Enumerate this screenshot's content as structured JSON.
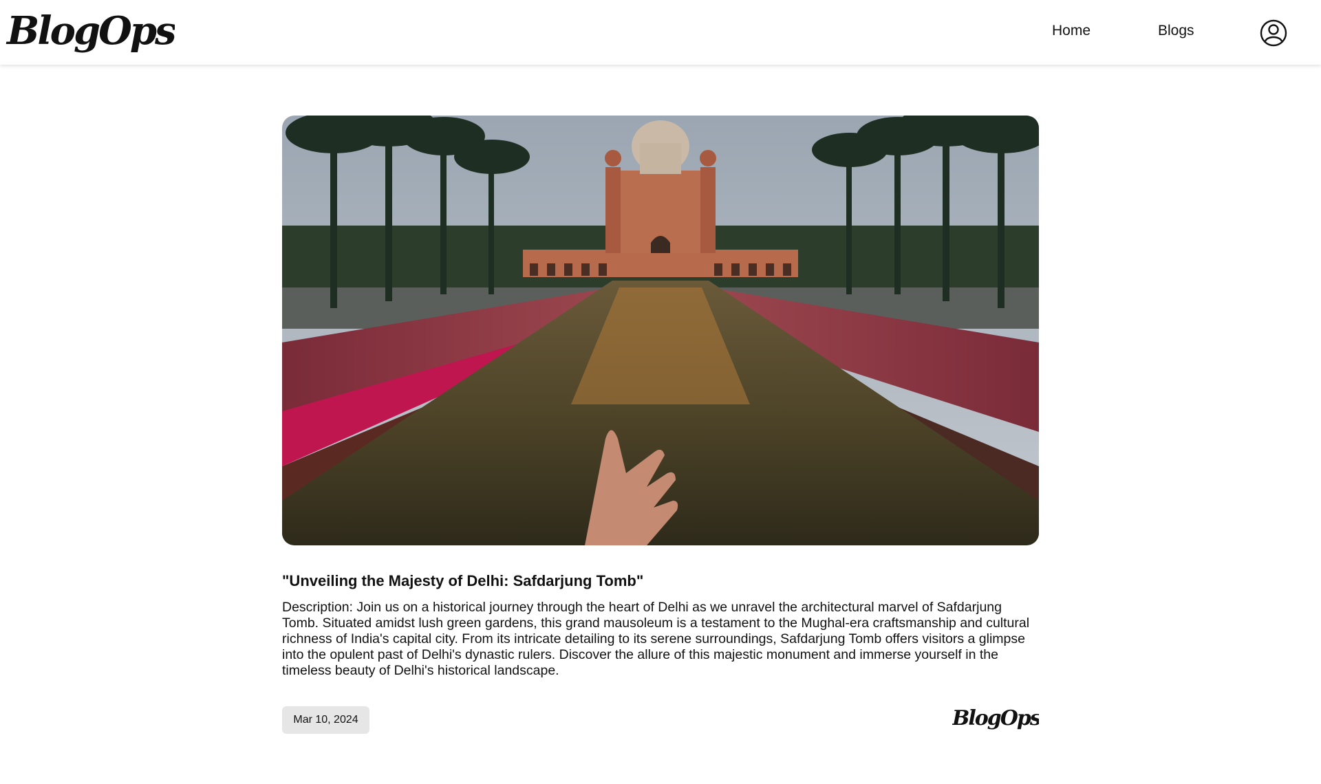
{
  "header": {
    "logo_text": "BlogOps",
    "nav": [
      {
        "label": "Home"
      },
      {
        "label": "Blogs"
      }
    ],
    "user_icon": "user-circle-icon"
  },
  "post": {
    "image_alt": "Safdarjung Tomb reflected in a rain-wet water channel with an outstretched hand in the foreground",
    "title": "\"Unveiling the Majesty of Delhi: Safdarjung Tomb\"",
    "description": "Description: Join us on a historical journey through the heart of Delhi as we unravel the architectural marvel of Safdarjung Tomb. Situated amidst lush green gardens, this grand mausoleum is a testament to the Mughal-era craftsmanship and cultural richness of India's capital city. From its intricate detailing to its serene surroundings, Safdarjung Tomb offers visitors a glimpse into the opulent past of Delhi's dynastic rulers. Discover the allure of this majestic monument and immerse yourself in the timeless beauty of Delhi's historical landscape.",
    "date": "Mar 10, 2024",
    "footer_logo_text": "BlogOps"
  },
  "colors": {
    "header_bg": "#ffffff",
    "text": "#111111",
    "badge_bg": "#e6e6e6"
  }
}
